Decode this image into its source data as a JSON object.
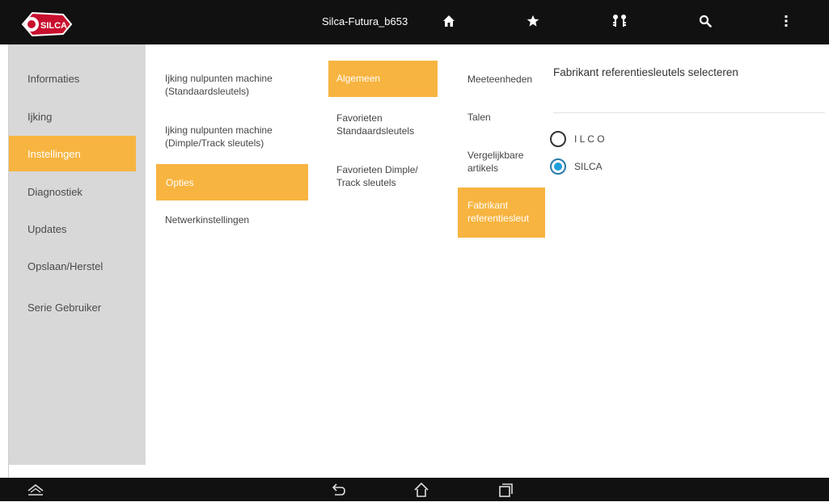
{
  "app": {
    "title": "Silca-Futura_b653",
    "logo_text": "SILCA",
    "brand_color": "#c8102e",
    "accent_color": "#f7b440"
  },
  "topbar": {
    "icons": [
      "home-icon",
      "star-icon",
      "keys-icon",
      "search-icon",
      "overflow-menu-icon"
    ]
  },
  "sidebar": {
    "items": [
      {
        "label": "Informaties",
        "active": false
      },
      {
        "label": "Ijking",
        "active": false
      },
      {
        "label": "Instellingen",
        "active": true
      },
      {
        "label": "Diagnostiek",
        "active": false
      },
      {
        "label": "Updates",
        "active": false
      },
      {
        "label": "Opslaan/Herstel",
        "active": false
      },
      {
        "label": "Serie Gebruiker",
        "active": false
      }
    ]
  },
  "column1": {
    "items": [
      {
        "label": "Ijking nulpunten machine (Standaardsleutels)",
        "active": false
      },
      {
        "label": "Ijking nulpunten machine (Dimple/Track sleutels)",
        "active": false
      },
      {
        "label": "Opties",
        "active": true
      },
      {
        "label": "Netwerkinstellingen",
        "active": false
      }
    ]
  },
  "column2": {
    "items": [
      {
        "label": "Algemeen",
        "active": true
      },
      {
        "label": "Favorieten Standaardsleutels",
        "active": false
      },
      {
        "label": "Favorieten Dimple/ Track sleutels",
        "active": false
      }
    ]
  },
  "column3": {
    "items": [
      {
        "label": "Meeteenheden",
        "active": false
      },
      {
        "label": "Talen",
        "active": false
      },
      {
        "label": "Vergelijkbare artikels",
        "active": false
      },
      {
        "label": "Fabrikant referentiesleut",
        "active": true
      }
    ]
  },
  "panel": {
    "title": "Fabrikant referentiesleutels selecteren",
    "options": [
      {
        "label": "I L C O",
        "checked": false
      },
      {
        "label": "SILCA",
        "checked": true
      }
    ]
  },
  "navbar": {
    "icons": [
      "collapse-icon",
      "back-icon",
      "home-nav-icon",
      "recent-apps-icon"
    ]
  }
}
